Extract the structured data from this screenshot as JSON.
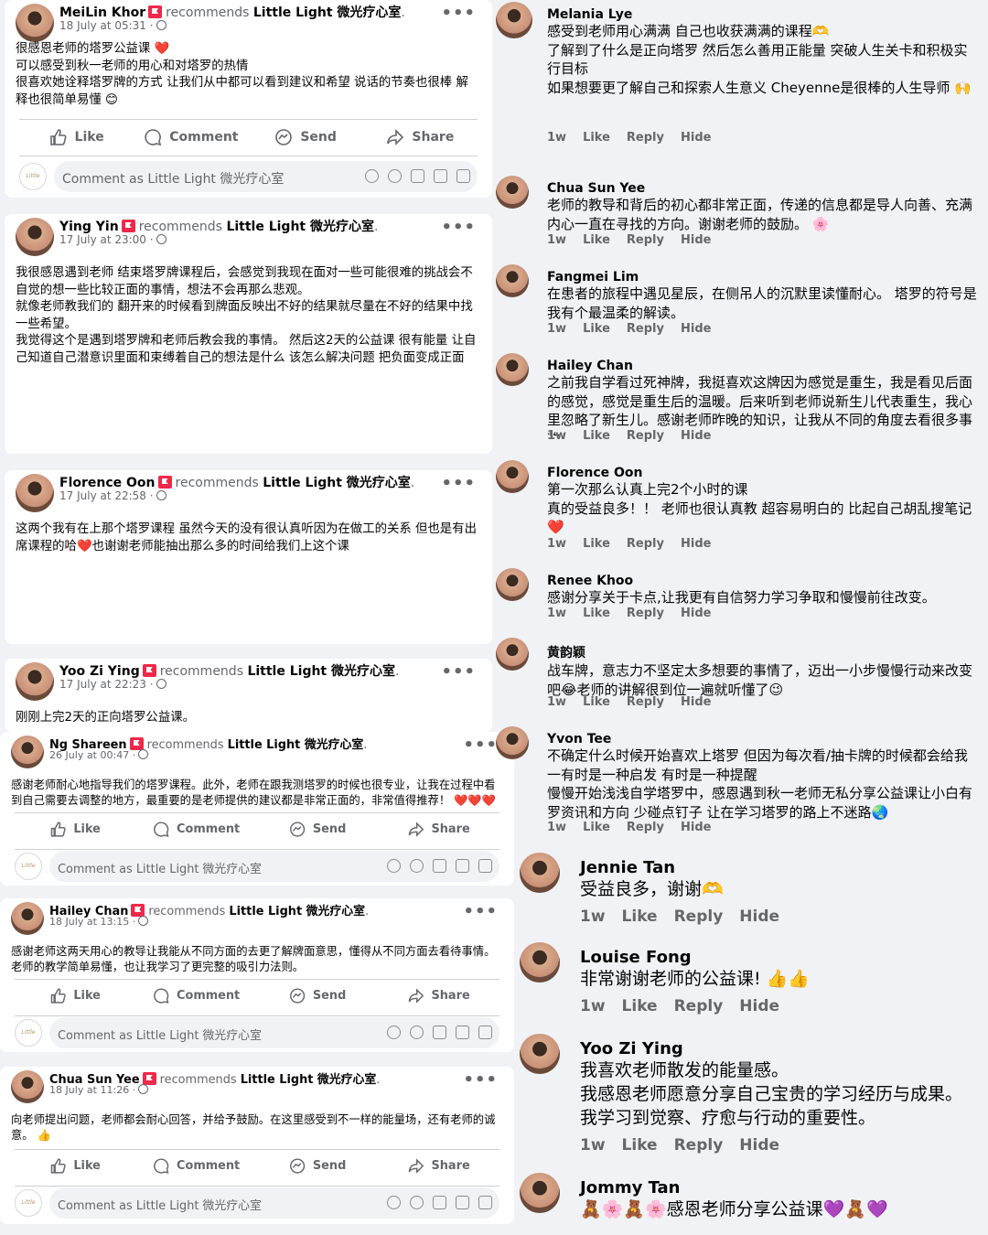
{
  "left_posts": [
    {
      "author": "MeiLin Khor",
      "recommends": "recommends",
      "page": "Little Light 微光疗心室",
      "time": "18 July at 05:31 ·",
      "body": "很感恩老师的塔罗公益课 ❤️\n可以感受到秋一老师的用心和对塔罗的热情\n很喜欢她诠释塔罗牌的方式 让我们从中都可以看到建议和希望 说话的节奏也很棒 解释也很简单易懂 😊"
    },
    {
      "author": "Ying Yin",
      "recommends": "recommends",
      "page": "Little Light 微光疗心室",
      "time": "17 July at 23:00 ·",
      "body": "我很感恩遇到老师 结束塔罗牌课程后，会感觉到我现在面对一些可能很难的挑战会不自觉的想一些比较正面的事情，想法不会再那么悲观。\n就像老师教我们的 翻开来的时候看到牌面反映出不好的结果就尽量在不好的结果中找一些希望。\n我觉得这个是遇到塔罗牌和老师后教会我的事情。 然后这2天的公益课 很有能量 让自己知道自己潜意识里面和束缚着自己的想法是什么 该怎么解决问题 把负面变成正面"
    },
    {
      "author": "Florence Oon",
      "recommends": "recommends",
      "page": "Little Light 微光疗心室",
      "time": "17 July at 22:58 ·",
      "body": "这两个我有在上那个塔罗课程 虽然今天的没有很认真听因为在做工的关系 但也是有出席课程的哈❤️也谢谢老师能抽出那么多的时间给我们上这个课"
    },
    {
      "author": "Yoo Zi Ying",
      "recommends": "recommends",
      "page": "Little Light 微光疗心室",
      "time": "17 July at 22:23 ·",
      "body": "刚刚上完2天的正向塔罗公益课。"
    },
    {
      "author": "Ng Shareen",
      "recommends": "recommends",
      "page": "Little Light 微光疗心室",
      "time": "26 July at 00:47 ·",
      "body": "感谢老师耐心地指导我们的塔罗课程。此外，老师在跟我测塔罗的时候也很专业，让我在过程中看到自己需要去调整的地方，最重要的是老师提供的建议都是非常正面的，非常值得推荐！ ❤️❤️❤️"
    },
    {
      "author": "Hailey Chan",
      "recommends": "recommends",
      "page": "Little Light 微光疗心室",
      "time": "18 July at 13:15 ·",
      "body": "感谢老师这两天用心的教导让我能从不同方面的去更了解牌面意思，懂得从不同方面去看待事情。老师的教学简单易懂，也让我学习了更完整的吸引力法则。"
    },
    {
      "author": "Chua Sun Yee",
      "recommends": "recommends",
      "page": "Little Light 微光疗心室",
      "time": "18 July at 11:26 ·",
      "body": "向老师提出问题，老师都会耐心回答，并给予鼓励。在这里感受到不一样的能量场，还有老师的诚意。 👍"
    }
  ],
  "actions": {
    "like": "Like",
    "comment": "Comment",
    "send": "Send",
    "share": "Share"
  },
  "comment_placeholder": "Comment as Little Light 微光疗心室",
  "page_avatar_text": "Little Light",
  "more": "•••",
  "right_comments": [
    {
      "author": "Melania Lye",
      "text": "感受到老师用心满满 自己也收获满满的课程🫶\n了解到了什么是正向塔罗 然后怎么善用正能量 突破人生关卡和积极实行目标\n如果想要更了解自己和探索人生意义 Cheyenne是很棒的人生导师 🙌"
    },
    {
      "author": "Chua Sun Yee",
      "text": "老师的教导和背后的初心都非常正面，传递的信息都是导人向善、充满内心一直在寻找的方向。谢谢老师的鼓励。 🌸"
    },
    {
      "author": "Fangmei Lim",
      "text": "在患者的旅程中遇见星辰，在侧吊人的沉默里读懂耐心。 塔罗的符号是我有个最温柔的解读。"
    },
    {
      "author": "Hailey Chan",
      "text": "之前我自学看过死神牌，我挺喜欢这牌因为感觉是重生，我是看见后面的感觉，感觉是重生后的温暖。后来听到老师说新生儿代表重生，我心里忽略了新生儿。感谢老师昨晚的知识，让我从不同的角度去看很多事物。"
    },
    {
      "author": "Florence Oon",
      "text": "第一次那么认真上完2个小时的课\n真的受益良多！！ 老师也很认真教 超容易明白的 比起自己胡乱搜笔记 \n❤️"
    },
    {
      "author": "Renee Khoo",
      "text": "感谢分享关于卡点,让我更有自信努力学习争取和慢慢前往改变。"
    },
    {
      "author": "黄韵颖",
      "text": "战车牌，意志力不坚定太多想要的事情了，迈出一小步慢慢行动来改变吧😂老师的讲解很到位一遍就听懂了😉"
    },
    {
      "author": "Yvon Tee",
      "text": "不确定什么时候开始喜欢上塔罗 但因为每次看/抽卡牌的时候都会给我一有时是一种启发 有时是一种提醒\n慢慢开始浅浅自学塔罗中，感恩遇到秋一老师无私分享公益课让小白有罗资讯和方向 少碰点钉子 让在学习塔罗的路上不迷路🌏"
    },
    {
      "author": "Jennie Tan",
      "text": "受益良多，谢谢🫶"
    },
    {
      "author": "Louise Fong",
      "text": "非常谢谢老师的公益课! 👍👍"
    },
    {
      "author": "Yoo Zi Ying",
      "text": "我喜欢老师散发的能量感。\n我感恩老师愿意分享自己宝贵的学习经历与成果。\n我学习到觉察、疗愈与行动的重要性。"
    },
    {
      "author": "Jommy Tan",
      "text": "🧸🌸🧸🌸感恩老师分享公益课💜🧸💜"
    }
  ],
  "comment_actions": {
    "time": "1w",
    "like": "Like",
    "reply": "Reply",
    "hide": "Hide"
  },
  "colors": {
    "background": "#f0f2f5",
    "card": "#ffffff",
    "secondary_text": "#65676b",
    "badge": "#f02849"
  }
}
